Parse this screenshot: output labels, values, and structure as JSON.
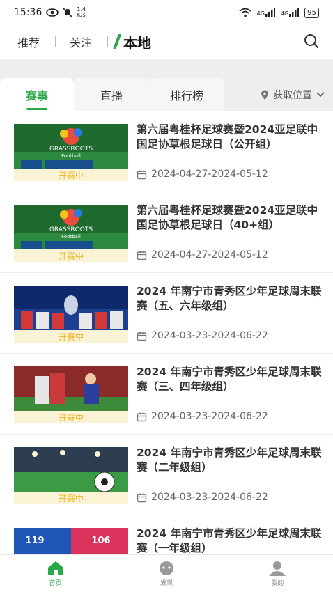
{
  "status_bar": {
    "time": "15:36",
    "net_speed_value": "1.4",
    "net_speed_unit": "K/s",
    "signal1": "4G",
    "signal2": "4G",
    "battery": "95"
  },
  "top_tabs": [
    {
      "label": "推荐",
      "active": false
    },
    {
      "label": "关注",
      "active": false
    },
    {
      "label": "本地",
      "active": true
    }
  ],
  "sub_tabs": [
    {
      "label": "赛事",
      "active": true
    },
    {
      "label": "直播",
      "active": false
    },
    {
      "label": "排行榜",
      "active": false
    }
  ],
  "location_label": "获取位置",
  "events": [
    {
      "title": "第六届粤桂杯足球赛暨2024亚足联中国足协草根足球日（公开组）",
      "date": "2024-04-27-2024-05-12",
      "status": "开赛中",
      "thumb": "grassroots"
    },
    {
      "title": "第六届粤桂杯足球赛暨2024亚足联中国足协草根足球日（40+组）",
      "date": "2024-04-27-2024-05-12",
      "status": "开赛中",
      "thumb": "grassroots"
    },
    {
      "title": "2024 年南宁市青秀区少年足球周末联赛（五、六年级组）",
      "date": "2024-03-23-2024-06-22",
      "status": "开赛中",
      "thumb": "trophy-team"
    },
    {
      "title": "2024 年南宁市青秀区少年足球周末联赛（三、四年级组）",
      "date": "2024-03-23-2024-06-22",
      "status": "开赛中",
      "thumb": "celebration"
    },
    {
      "title": "2024 年南宁市青秀区少年足球周末联赛（二年级组）",
      "date": "2024-03-23-2024-06-22",
      "status": "开赛中",
      "thumb": "stadium-ball"
    },
    {
      "title": "2024 年南宁市青秀区少年足球周末联赛（一年级组）",
      "date": "",
      "status": "",
      "thumb": "players"
    }
  ],
  "bottom_nav": [
    {
      "label": "首页",
      "icon": "home-icon",
      "active": true
    },
    {
      "label": "发现",
      "icon": "discover-icon",
      "active": false
    },
    {
      "label": "我的",
      "icon": "profile-icon",
      "active": false
    }
  ],
  "colors": {
    "accent": "#2aa84a",
    "badge_bg": "#fbf3d5",
    "badge_text": "#f0b323"
  }
}
